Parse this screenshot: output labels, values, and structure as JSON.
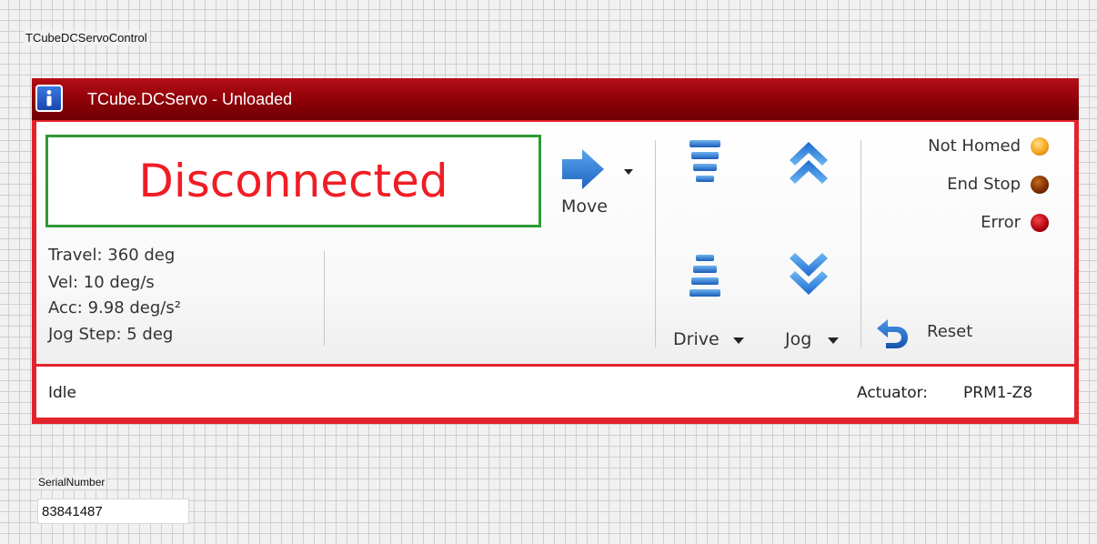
{
  "front_panel": {
    "control_label": "TCubeDCServoControl",
    "serial_label": "SerialNumber",
    "serial_value": "83841487"
  },
  "control": {
    "title": "TCube.DCServo - Unloaded",
    "display": "Disconnected",
    "info": {
      "travel": "Travel: 360 deg",
      "vel": "Vel: 10 deg/s",
      "acc": "Acc: 9.98 deg/s²",
      "jog_step": "Jog Step: 5 deg"
    },
    "buttons": {
      "move": "Move",
      "drive": "Drive",
      "jog": "Jog",
      "reset": "Reset"
    },
    "indicators": [
      {
        "label": "Not Homed",
        "color": "#f5a41d"
      },
      {
        "label": "End Stop",
        "color": "#7a2b00"
      },
      {
        "label": "Error",
        "color": "#b1000c"
      }
    ],
    "status": "Idle",
    "actuator_label": "Actuator:",
    "actuator_value": "PRM1-Z8"
  },
  "colors": {
    "title_bar": "#8d0008",
    "panel_border": "#e3232b",
    "display_text": "#f01d25",
    "display_border": "#2f9a34",
    "arrow_blue": "#2a7fd8"
  }
}
